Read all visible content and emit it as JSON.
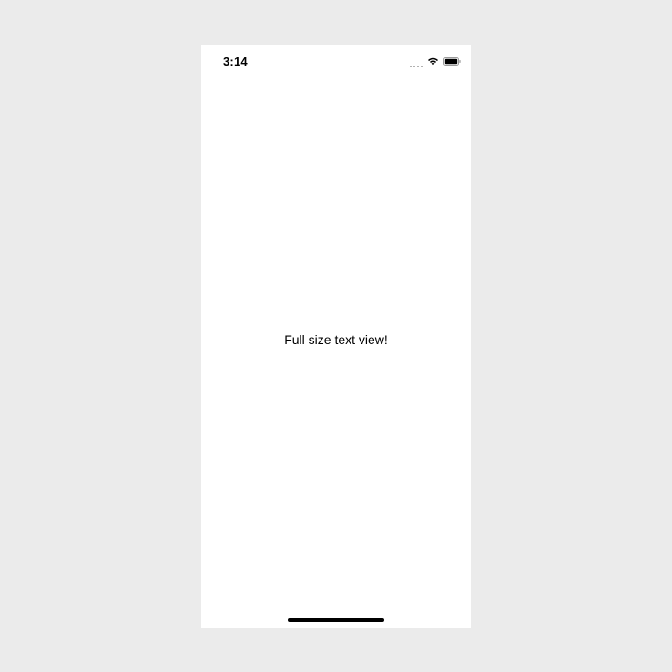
{
  "status_bar": {
    "time": "3:14",
    "icons": [
      "cellular-signal-icon",
      "wifi-icon",
      "battery-icon"
    ]
  },
  "main": {
    "text": "Full size text view!"
  },
  "colors": {
    "background": "#ebebeb",
    "screen": "#ffffff",
    "text": "#000000"
  }
}
